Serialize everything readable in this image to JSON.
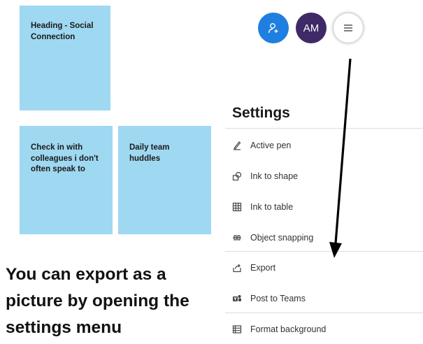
{
  "notes": [
    {
      "text": "Heading - Social Connection"
    },
    {
      "text": "Check in with colleagues i don't often speak to"
    },
    {
      "text": "Daily team huddles"
    }
  ],
  "caption": "You can export as a picture by opening the settings menu",
  "header": {
    "avatar_initials": "AM",
    "icons": [
      "add-user-icon",
      "menu-icon"
    ]
  },
  "settings": {
    "title": "Settings",
    "items": [
      {
        "label": "Active pen",
        "icon": "pen-icon"
      },
      {
        "label": "Ink to shape",
        "icon": "shape-icon"
      },
      {
        "label": "Ink to table",
        "icon": "table-icon"
      },
      {
        "label": "Object snapping",
        "icon": "snapping-icon"
      },
      {
        "label": "Export",
        "icon": "export-icon"
      },
      {
        "label": "Post to Teams",
        "icon": "teams-icon"
      },
      {
        "label": "Format background",
        "icon": "background-icon"
      }
    ]
  },
  "colors": {
    "note_bg": "#9fd8f1",
    "user_avatar": "#1f7fe0",
    "am_avatar": "#3e2a66"
  }
}
